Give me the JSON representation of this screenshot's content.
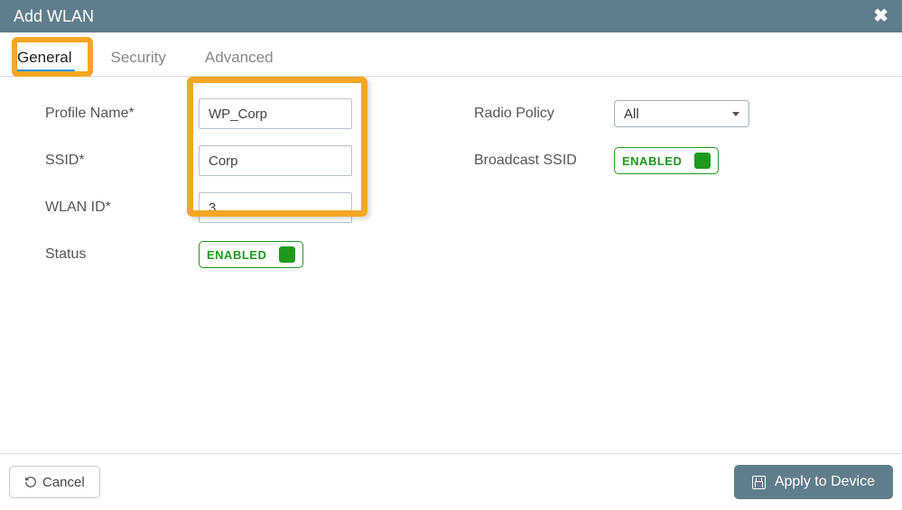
{
  "header": {
    "title": "Add WLAN"
  },
  "tabs": {
    "general": "General",
    "security": "Security",
    "advanced": "Advanced"
  },
  "form": {
    "profile_name_label": "Profile Name*",
    "profile_name_value": "WP_Corp",
    "ssid_label": "SSID*",
    "ssid_value": "Corp",
    "wlan_id_label": "WLAN ID*",
    "wlan_id_value": "3",
    "status_label": "Status",
    "status_toggle": "ENABLED",
    "radio_policy_label": "Radio Policy",
    "radio_policy_value": "All",
    "broadcast_ssid_label": "Broadcast SSID",
    "broadcast_ssid_toggle": "ENABLED"
  },
  "footer": {
    "cancel": "Cancel",
    "apply": "Apply to Device"
  }
}
